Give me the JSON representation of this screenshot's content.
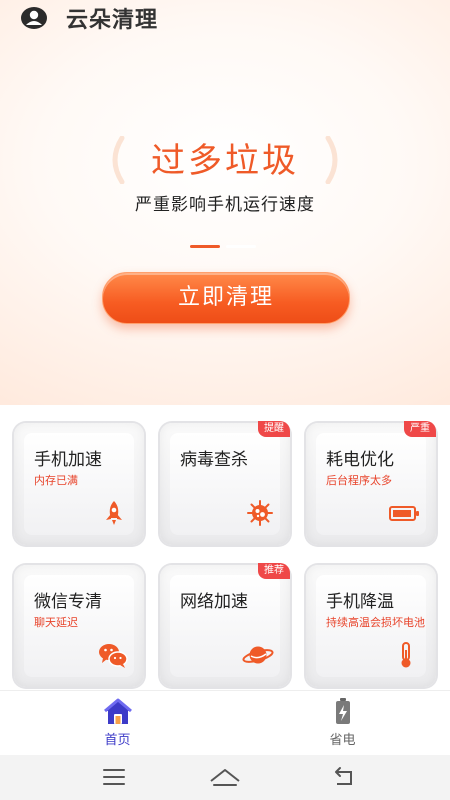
{
  "app": {
    "title": "云朵清理"
  },
  "hero": {
    "headline": "过多垃圾",
    "subtitle": "严重影响手机运行速度",
    "button_label": "立即清理"
  },
  "features": [
    {
      "title": "手机加速",
      "subtitle": "内存已满",
      "badge": "",
      "icon": "rocket-icon"
    },
    {
      "title": "病毒查杀",
      "subtitle": "",
      "badge": "提醒",
      "icon": "virus-icon"
    },
    {
      "title": "耗电优化",
      "subtitle": "后台程序太多",
      "badge": "严重",
      "icon": "battery-icon"
    },
    {
      "title": "微信专清",
      "subtitle": "聊天延迟",
      "badge": "",
      "icon": "wechat-icon"
    },
    {
      "title": "网络加速",
      "subtitle": "",
      "badge": "推荐",
      "icon": "planet-icon"
    },
    {
      "title": "手机降温",
      "subtitle": "持续高温会损坏电池",
      "badge": "",
      "icon": "thermometer-icon"
    }
  ],
  "tabs": [
    {
      "label": "首页",
      "active": true,
      "icon": "home-icon"
    },
    {
      "label": "省电",
      "active": false,
      "icon": "battery-charging-icon"
    }
  ],
  "colors": {
    "accent": "#ef5a28",
    "badge": "#ef4848",
    "tab_active": "#3d3bc8",
    "tab_inactive": "#666666"
  }
}
